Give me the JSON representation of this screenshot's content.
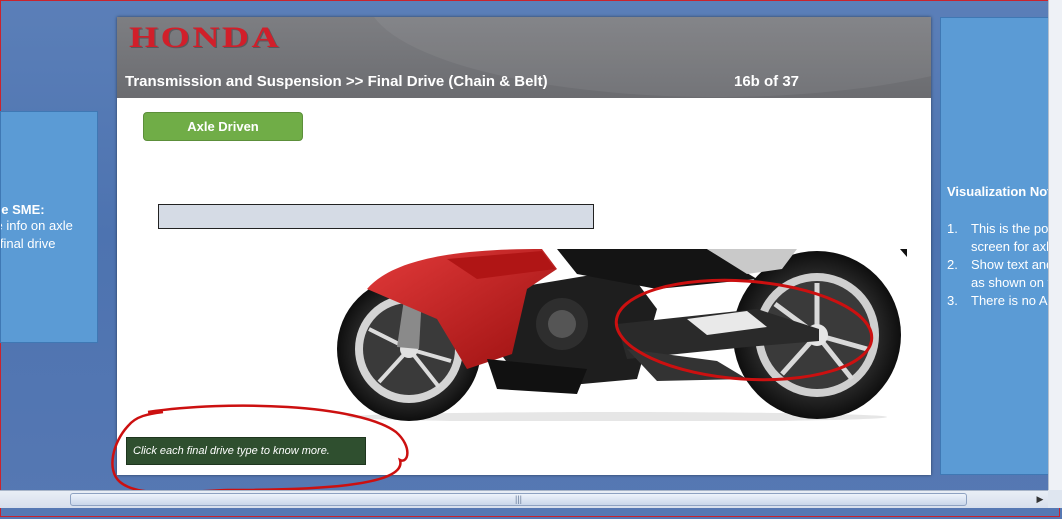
{
  "left_note": {
    "title": "the SME:",
    "lines": [
      "ve info on axle",
      "n final drive"
    ]
  },
  "slide": {
    "logo": "HONDA",
    "breadcrumb": "Transmission and Suspension >> Final Drive (Chain & Belt)",
    "page_indicator": "16b of 37",
    "axle_button_label": "Axle Driven",
    "instruction_text": "Click each final drive type to know more."
  },
  "right_note": {
    "title": "Visualization Not",
    "items": [
      {
        "num": "1.",
        "lines": [
          "This is the po",
          "screen for axl"
        ]
      },
      {
        "num": "2.",
        "lines": [
          "Show text and",
          "as shown on t"
        ]
      },
      {
        "num": "3.",
        "lines": [
          "There is no A"
        ]
      }
    ]
  },
  "colors": {
    "header_gray": "#6b6c70",
    "honda_red": "#d11f2a",
    "button_green": "#70ad47",
    "note_blue": "#5b9bd5",
    "annotation_red": "#cc1010"
  },
  "icons": {
    "scroll_right": "scroll-right-arrow-icon",
    "scroll_down": "scroll-down-arrow-icon"
  }
}
